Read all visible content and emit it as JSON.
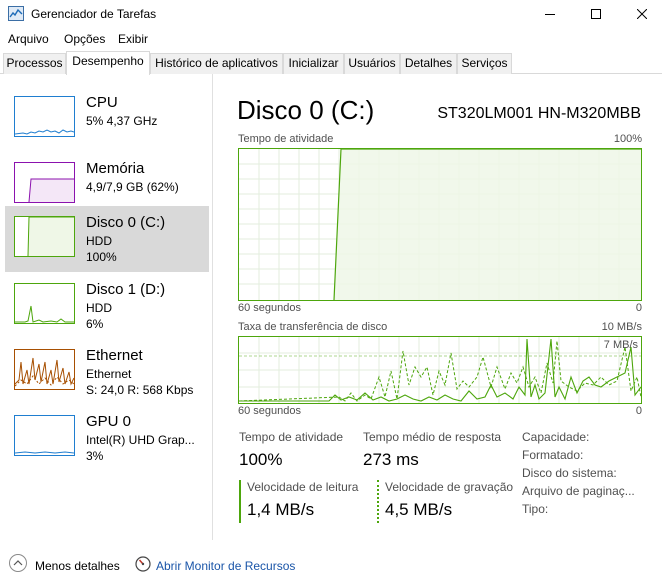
{
  "window": {
    "title": "Gerenciador de Tarefas",
    "controls": [
      "minimize-icon",
      "maximize-icon",
      "close-icon"
    ]
  },
  "menu": [
    "Arquivo",
    "Opções",
    "Exibir"
  ],
  "tabs": [
    {
      "label": "Processos",
      "active": false
    },
    {
      "label": "Desempenho",
      "active": true
    },
    {
      "label": "Histórico de aplicativos",
      "active": false
    },
    {
      "label": "Inicializar",
      "active": false
    },
    {
      "label": "Usuários",
      "active": false
    },
    {
      "label": "Detalhes",
      "active": false
    },
    {
      "label": "Serviços",
      "active": false
    }
  ],
  "sidebar": {
    "items": [
      {
        "name": "CPU",
        "line1": "5% 4,37 GHz",
        "line2": "",
        "color": "#1f7ed0",
        "selected": false
      },
      {
        "name": "Memória",
        "line1": "4,9/7,9 GB (62%)",
        "line2": "",
        "color": "#8b12ae",
        "selected": false
      },
      {
        "name": "Disco 0 (C:)",
        "line1": "HDD",
        "line2": "100%",
        "color": "#4da60c",
        "selected": true
      },
      {
        "name": "Disco 1 (D:)",
        "line1": "HDD",
        "line2": "6%",
        "color": "#4da60c",
        "selected": false
      },
      {
        "name": "Ethernet",
        "line1": "Ethernet",
        "line2": "S: 24,0 R: 568 Kbps",
        "color": "#a74f01",
        "selected": false
      },
      {
        "name": "GPU 0",
        "line1": "Intel(R) UHD Grap...",
        "line2": "3%",
        "color": "#1f7ed0",
        "selected": false
      }
    ]
  },
  "main": {
    "title": "Disco 0 (C:)",
    "model": "ST320LM001 HN-M320MBB",
    "graph1": {
      "label": "Tempo de atividade",
      "max_label": "100%",
      "x_left": "60 segundos",
      "x_right": "0"
    },
    "graph2": {
      "label": "Taxa de transferência de disco",
      "max_label": "10 MB/s",
      "inner_label": "7 MB/s",
      "x_left": "60 segundos",
      "x_right": "0"
    },
    "stats": {
      "activity_label": "Tempo de atividade",
      "activity_value": "100%",
      "response_label": "Tempo médio de resposta",
      "response_value": "273 ms",
      "read_label": "Velocidade de leitura",
      "read_value": "1,4 MB/s",
      "write_label": "Velocidade de gravação",
      "write_value": "4,5 MB/s"
    },
    "properties": [
      "Capacidade:",
      "Formatado:",
      "Disco do sistema:",
      "Arquivo de paginaç...",
      "Tipo:"
    ]
  },
  "footer": {
    "less_details": "Menos detalhes",
    "resource_monitor": "Abrir Monitor de Recursos"
  },
  "colors": {
    "disk": "#4da60c",
    "disk_fill": "#eff7e7",
    "cpu": "#1f7ed0",
    "memory": "#8b12ae",
    "ethernet": "#a74f01",
    "selected_bg": "#d9d9d9",
    "link": "#1a55a8"
  }
}
